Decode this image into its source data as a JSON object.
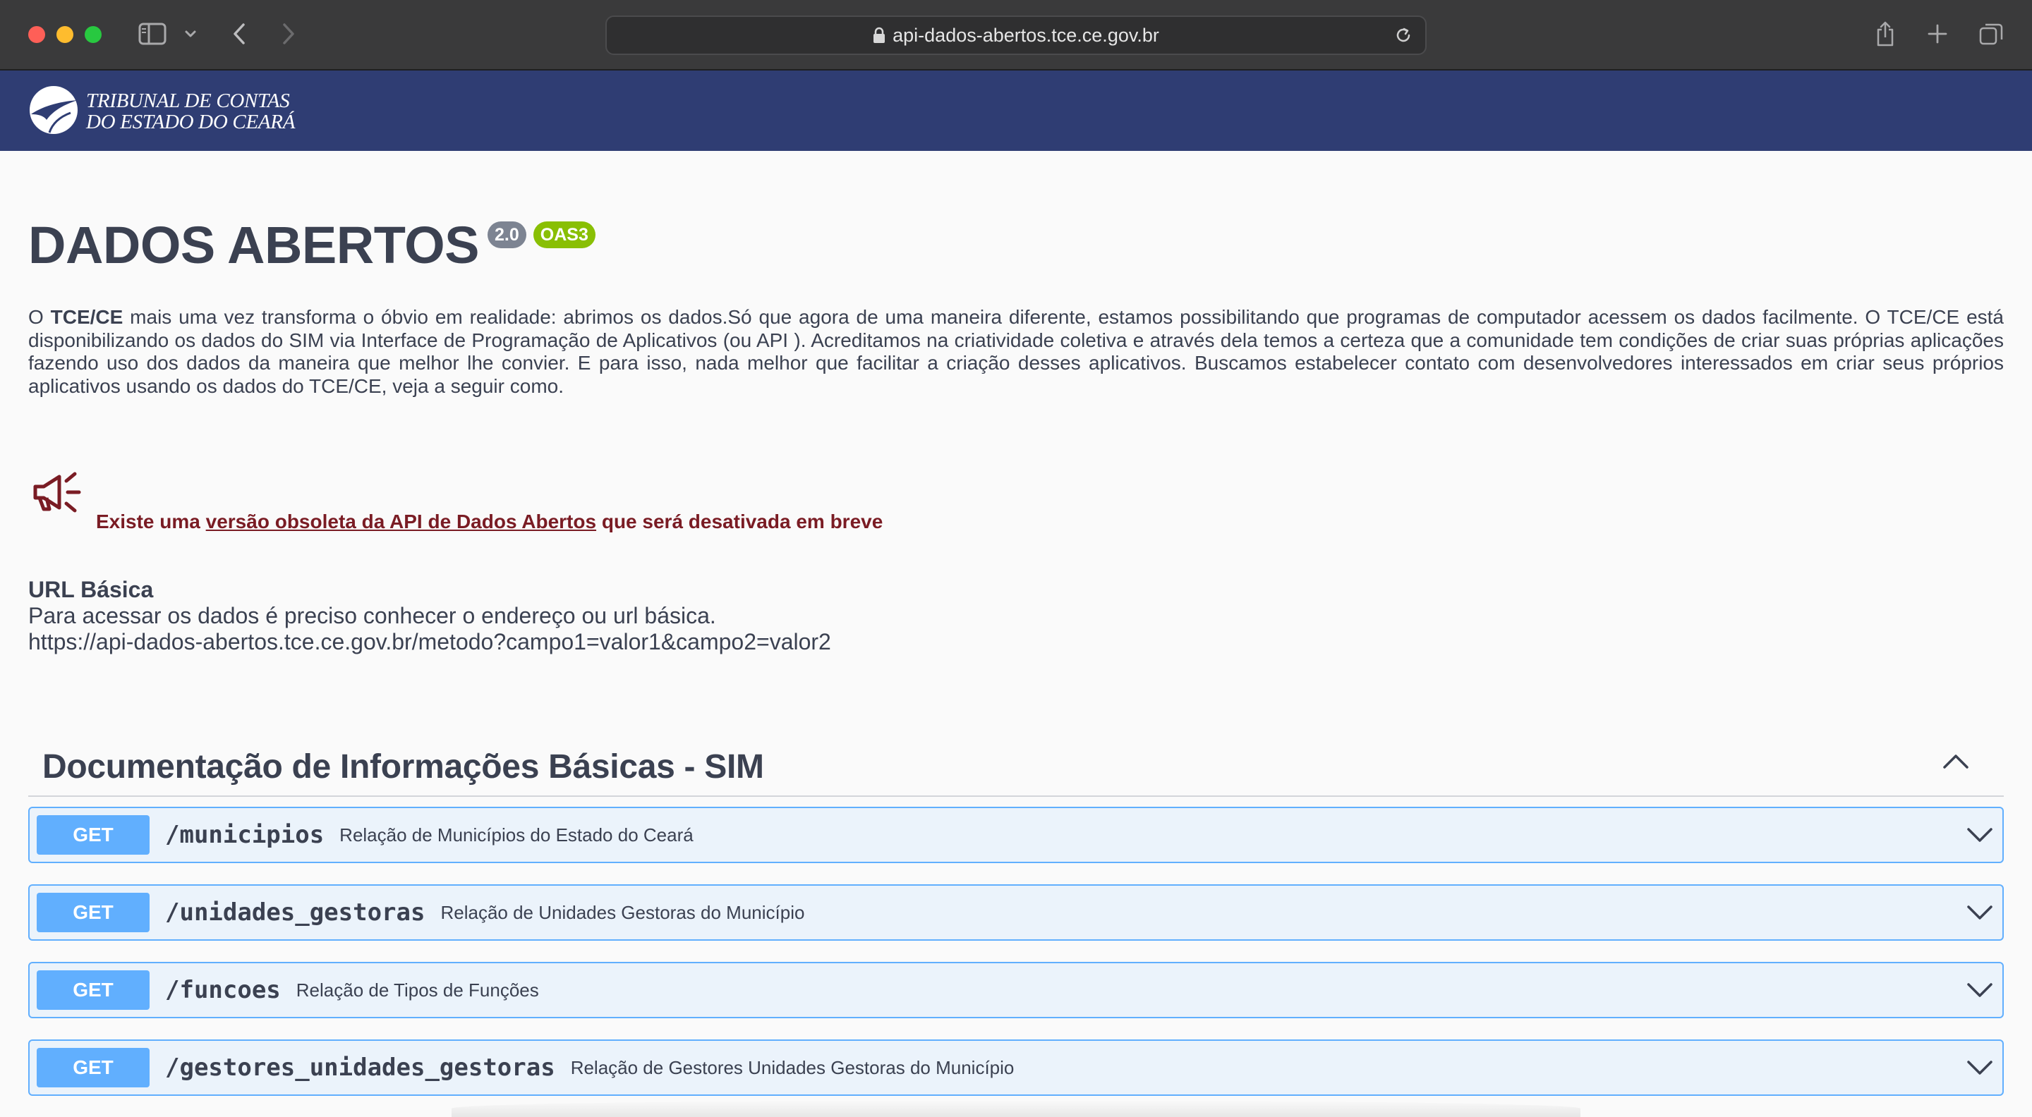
{
  "browser": {
    "url": "api-dados-abertos.tce.ce.gov.br",
    "icons": [
      "sidebar-icon",
      "chevron-down-icon",
      "back-icon",
      "forward-icon",
      "lock-icon",
      "reload-icon",
      "share-icon",
      "new-tab-icon",
      "tabs-overview-icon"
    ]
  },
  "header": {
    "logo_line1": "TRIBUNAL DE CONTAS",
    "logo_line2": "DO ESTADO DO CEARÁ",
    "background": "#2f3d73"
  },
  "info": {
    "title": "DADOS ABERTOS",
    "version_badge": "2.0",
    "spec_badge": "OAS3",
    "description_prefix": "O ",
    "description_bold": "TCE/CE",
    "description_rest": " mais uma vez transforma o óbvio em realidade: abrimos os dados.Só que agora de uma maneira diferente, estamos possibilitando que programas de computador acessem os dados facilmente. O TCE/CE está disponibilizando os dados do SIM via Interface de Programação de Aplicativos (ou API ). Acreditamos na criatividade coletiva e através dela temos a certeza que a comunidade tem condições de criar suas próprias aplicações fazendo uso dos dados da maneira que melhor lhe convier. E para isso, nada melhor que facilitar a criação desses aplicativos. Buscamos estabelecer contato com desenvolvedores interessados em criar seus próprios aplicativos usando os dados do TCE/CE, veja a seguir como."
  },
  "notice": {
    "prefix": "Existe uma ",
    "link_text": "versão obsoleta da API de Dados Abertos",
    "suffix": " que será desativada em breve",
    "color": "#7a1c24"
  },
  "base_url": {
    "heading": "URL Básica",
    "text": "Para acessar os dados é preciso conhecer o endereço ou url básica.",
    "example": "https://api-dados-abertos.tce.ce.gov.br/metodo?campo1=valor1&campo2=valor2"
  },
  "section": {
    "title": "Documentação de Informações Básicas - SIM"
  },
  "operations": [
    {
      "method": "GET",
      "path": "/municipios",
      "summary": "Relação de Municípios do Estado do Ceará"
    },
    {
      "method": "GET",
      "path": "/unidades_gestoras",
      "summary": "Relação de Unidades Gestoras do Município"
    },
    {
      "method": "GET",
      "path": "/funcoes",
      "summary": "Relação de Tipos de Funções"
    },
    {
      "method": "GET",
      "path": "/gestores_unidades_gestoras",
      "summary": "Relação de Gestores Unidades Gestoras do Município"
    }
  ],
  "colors": {
    "get_method": "#61affe",
    "get_background": "#ebf3fb",
    "text": "#3b4151",
    "oas_badge": "#89bf04",
    "version_badge": "#7d8492"
  }
}
